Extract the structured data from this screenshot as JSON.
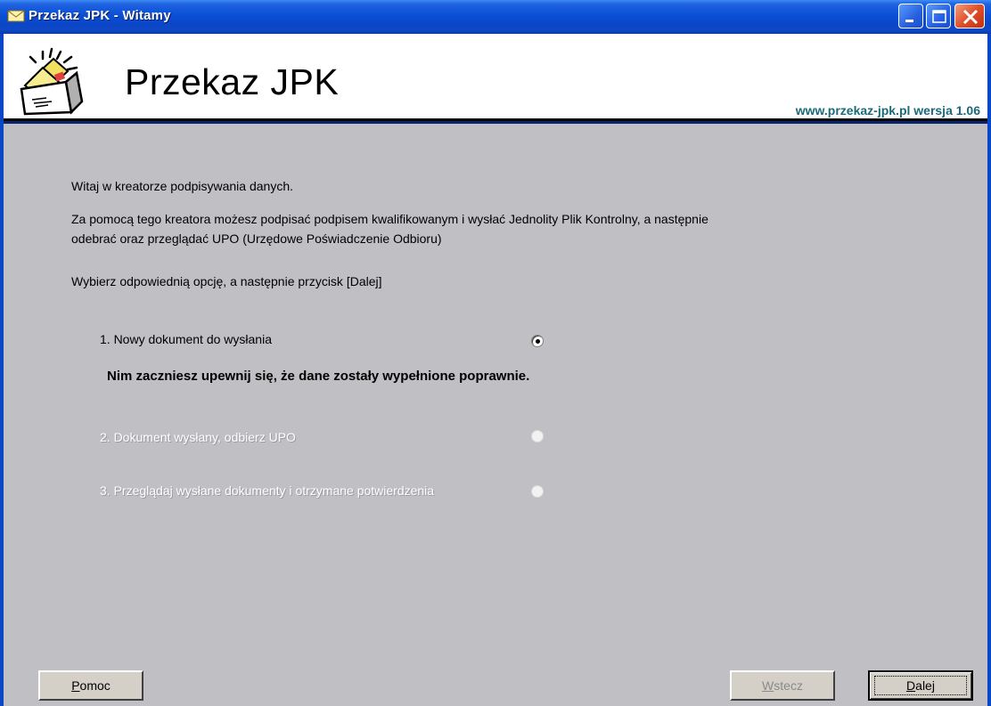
{
  "window": {
    "title": "Przekaz JPK - Witamy"
  },
  "header": {
    "app_title": "Przekaz JPK",
    "site_version": "www.przekaz-jpk.pl wersja 1.06"
  },
  "content": {
    "intro_1": "Witaj w kreatorze podpisywania danych.",
    "intro_2a": "Za pomocą tego kreatora możesz podpisać podpisem kwalifikowanym i wysłać Jednolity Plik Kontrolny, a następnie",
    "intro_2b": "odebrać oraz przeglądać UPO (Urzędowe Poświadczenie Odbioru)",
    "intro_3": "Wybierz odpowiednią opcję, a następnie przycisk [Dalej]",
    "options": [
      {
        "label": "1. Nowy dokument do wysłania",
        "selected": true,
        "enabled": true
      },
      {
        "label": "2. Dokument wysłany, odbierz UPO",
        "selected": false,
        "enabled": false
      },
      {
        "label": "3. Przeglądaj wysłane dokumenty i otrzymane potwierdzenia",
        "selected": false,
        "enabled": false
      }
    ],
    "warning": "Nim zaczniesz upewnij się, że dane zostały wypełnione poprawnie."
  },
  "buttons": {
    "help_first": "P",
    "help_rest": "omoc",
    "back_first": "W",
    "back_rest": "stecz",
    "next_first": "D",
    "next_rest": "alej"
  },
  "colors": {
    "titlebar": "#0a46c8",
    "content_bg": "#c0c0c4",
    "site_version": "#1a6a78"
  },
  "icons": [
    "envelope-icon",
    "minimize-icon",
    "maximize-icon",
    "close-icon",
    "mail-logo-icon"
  ]
}
